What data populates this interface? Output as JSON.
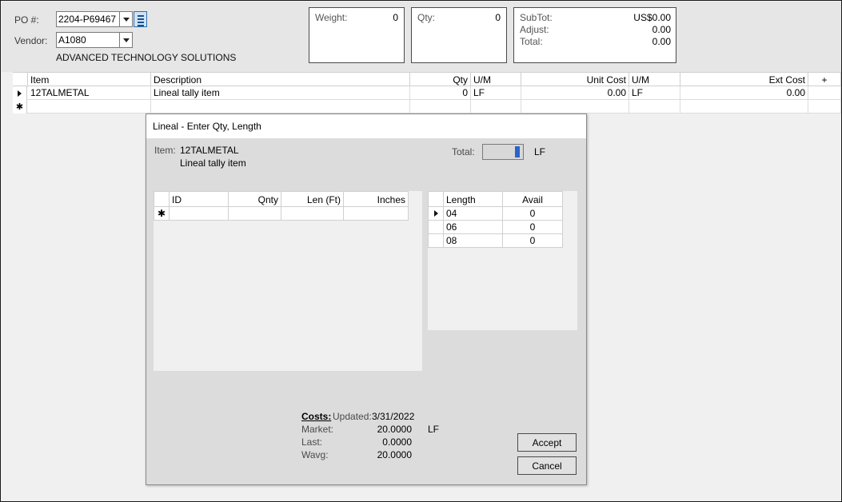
{
  "header": {
    "po_label": "PO #:",
    "po_value": "2204-P69467",
    "vendor_label": "Vendor:",
    "vendor_value": "A1080",
    "vendor_name": "ADVANCED TECHNOLOGY SOLUTIONS"
  },
  "summary": {
    "weight_label": "Weight:",
    "weight_value": "0",
    "qty_label": "Qty:",
    "qty_value": "0",
    "subtot_label": "SubTot:",
    "subtot_value": "US$0.00",
    "adjust_label": "Adjust:",
    "adjust_value": "0.00",
    "total_label": "Total:",
    "total_value": "0.00"
  },
  "grid": {
    "columns": [
      "Item",
      "Description",
      "Qty",
      "U/M",
      "Unit Cost",
      "U/M",
      "Ext Cost",
      "+"
    ],
    "rows": [
      [
        "12TALMETAL",
        "Lineal tally item",
        "0",
        "LF",
        "0.00",
        "LF",
        "0.00",
        ""
      ]
    ],
    "new_row_marker": "✱"
  },
  "dialog": {
    "title": "Lineal - Enter Qty, Length",
    "item_label": "Item:",
    "item_code": "12TALMETAL",
    "item_desc": "Lineal tally item",
    "total_label": "Total:",
    "total_unit": "LF",
    "tally_columns": [
      "ID",
      "Qnty",
      "Len (Ft)",
      "Inches"
    ],
    "new_row_marker": "✱",
    "length_columns": [
      "Length",
      "Avail"
    ],
    "lengths": [
      {
        "length": "04",
        "avail": "0"
      },
      {
        "length": "06",
        "avail": "0"
      },
      {
        "length": "08",
        "avail": "0"
      }
    ],
    "costs": {
      "heading": "Costs:",
      "updated_label": "Updated:",
      "updated_date": "3/31/2022",
      "market_label": "Market:",
      "market_value": "20.0000",
      "market_unit": "LF",
      "last_label": "Last:",
      "last_value": "0.0000",
      "wavg_label": "Wavg:",
      "wavg_value": "20.0000"
    },
    "accept_label": "Accept",
    "cancel_label": "Cancel"
  }
}
